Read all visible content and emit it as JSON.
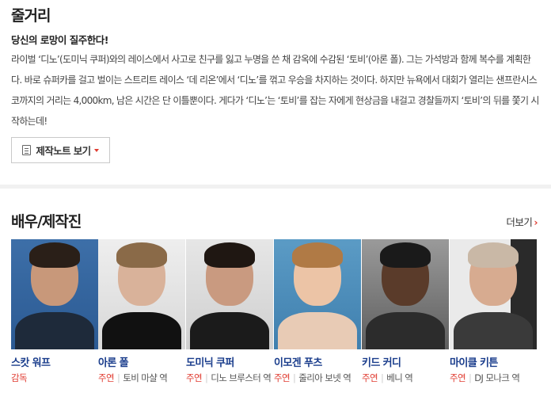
{
  "synopsis": {
    "title": "줄거리",
    "tagline": "당신의 로망이 질주한다!",
    "body": "라이벌 ‘디노’(도미닉 쿠퍼)와의 레이스에서 사고로 친구를 잃고 누명을 쓴 채 감옥에 수감된 ‘토비’(아론 폴). 그는 가석방과 함께 복수를 계획한다. 바로 슈퍼카를 걸고 벌이는 스트리트 레이스 ‘데 리온’에서 ‘디노’를 꺾고 우승을 차지하는 것이다. 하지만 뉴욕에서 대회가 열리는 샌프란시스코까지의 거리는 4,000km, 남은 시간은 단 이틀뿐이다. 게다가 ‘디노’는 ‘토비’를 잡는 자에게 현상금을 내걸고 경찰들까지 ‘토비’의 뒤를 쫓기 시작하는데!",
    "notes_button": "제작노트 보기"
  },
  "cast": {
    "title": "배우/제작진",
    "more": "더보기",
    "members": [
      {
        "name": "스캇 워프",
        "type": "감독",
        "role": ""
      },
      {
        "name": "아론 폴",
        "type": "주연",
        "role": "토비 마샬 역"
      },
      {
        "name": "도미닉 쿠퍼",
        "type": "주연",
        "role": "디노 브루스터 역"
      },
      {
        "name": "이모겐 푸츠",
        "type": "주연",
        "role": "줄리아 보넷 역"
      },
      {
        "name": "키드 커디",
        "type": "주연",
        "role": "베니 역"
      },
      {
        "name": "마이클 키튼",
        "type": "주연",
        "role": "DJ 모나크 역"
      }
    ]
  },
  "colors": {
    "accent_red": "#e03c31",
    "name_blue": "#1a3d8c"
  }
}
